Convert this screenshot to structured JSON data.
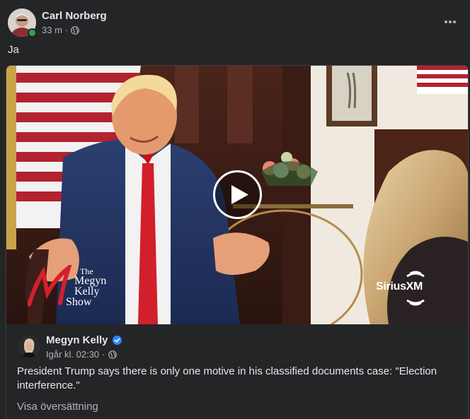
{
  "post": {
    "author": "Carl Norberg",
    "time": "33 m",
    "separator": "·",
    "privacy_icon": "globe-icon",
    "more_icon": "more-options-icon",
    "text": "Ja"
  },
  "shared_post": {
    "author": "Megyn Kelly",
    "verified_icon": "verified-badge-icon",
    "time": "Igår kl. 02:30",
    "separator": "·",
    "privacy_icon": "globe-icon",
    "text": "President Trump says there is only one motive in his classified documents case: \"Election interference.\"",
    "translate_link": "Visa översättning"
  },
  "video": {
    "play_icon": "play-icon",
    "watermark_left": {
      "the": "The",
      "megyn": "Megyn",
      "kelly": "Kelly",
      "show": "Show"
    },
    "watermark_right": "SiriusXM"
  },
  "colors": {
    "background": "#242526",
    "text_primary": "#e4e6eb",
    "text_secondary": "#b0b3b8",
    "online": "#31a24c",
    "verified": "#2d88ff",
    "border": "#3e4042"
  }
}
